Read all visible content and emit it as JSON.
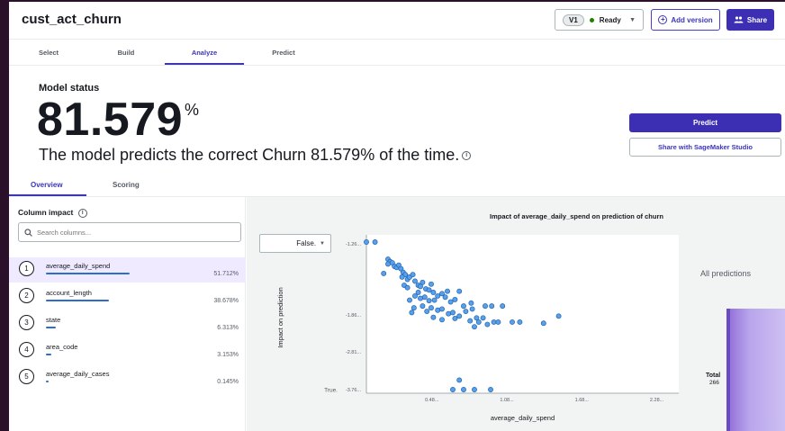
{
  "header": {
    "title": "cust_act_churn",
    "version_badge": "V1",
    "version_status": "Ready",
    "add_version_label": "Add version",
    "share_label": "Share"
  },
  "steps": [
    {
      "label": "Select"
    },
    {
      "label": "Build"
    },
    {
      "label": "Analyze"
    },
    {
      "label": "Predict"
    }
  ],
  "model_status": {
    "label": "Model status",
    "accuracy": "81.579",
    "unit": "%",
    "sentence": "The model predicts the correct Churn 81.579% of the time."
  },
  "actions": {
    "predict_label": "Predict",
    "studio_label": "Share with SageMaker Studio"
  },
  "subtabs": [
    {
      "label": "Overview"
    },
    {
      "label": "Scoring"
    }
  ],
  "column_impact": {
    "title": "Column impact",
    "search_placeholder": "Search columns...",
    "features": [
      {
        "rank": "1",
        "name": "average_daily_spend",
        "pct": "51.712%",
        "share": 0.517
      },
      {
        "rank": "2",
        "name": "account_length",
        "pct": "38.678%",
        "share": 0.387
      },
      {
        "rank": "3",
        "name": "state",
        "pct": "6.313%",
        "share": 0.063
      },
      {
        "rank": "4",
        "name": "area_code",
        "pct": "3.153%",
        "share": 0.032
      },
      {
        "rank": "5",
        "name": "average_daily_cases",
        "pct": "0.145%",
        "share": 0.0015
      }
    ]
  },
  "impact_chart": {
    "dropdown_value": "False.",
    "all_predictions_label": "All predictions",
    "total_label": "Total",
    "total_value": "266"
  },
  "chart_data": {
    "type": "scatter",
    "title": "Impact of average_daily_spend on prediction of churn",
    "xlabel": "average_daily_spend",
    "ylabel": "Impact on prediction",
    "x_ticks": [
      "0.48...",
      "1.08...",
      "1.68...",
      "2.28..."
    ],
    "y_ticks": [
      "-1.26...",
      "-1.86...",
      "-2.81...",
      "-3.76..."
    ],
    "y_end_labels": [
      "False.",
      "True."
    ],
    "grid": false,
    "points": [
      {
        "x": 0.0,
        "y": -1.27
      },
      {
        "x": 0.08,
        "y": -1.27
      },
      {
        "x": 0.2,
        "y": -1.56
      },
      {
        "x": 0.22,
        "y": -1.6
      },
      {
        "x": 0.2,
        "y": -1.64
      },
      {
        "x": 0.24,
        "y": -1.62
      },
      {
        "x": 0.26,
        "y": -1.68
      },
      {
        "x": 0.28,
        "y": -1.7
      },
      {
        "x": 0.3,
        "y": -1.66
      },
      {
        "x": 0.32,
        "y": -1.72
      },
      {
        "x": 0.34,
        "y": -1.78
      },
      {
        "x": 0.36,
        "y": -1.82
      },
      {
        "x": 0.33,
        "y": -1.86
      },
      {
        "x": 0.38,
        "y": -1.9
      },
      {
        "x": 0.4,
        "y": -1.86
      },
      {
        "x": 0.43,
        "y": -1.82
      },
      {
        "x": 0.45,
        "y": -1.93
      },
      {
        "x": 0.16,
        "y": -1.8
      },
      {
        "x": 0.35,
        "y": -2.0
      },
      {
        "x": 0.38,
        "y": -2.04
      },
      {
        "x": 0.48,
        "y": -2.0
      },
      {
        "x": 0.52,
        "y": -1.95
      },
      {
        "x": 0.55,
        "y": -2.06
      },
      {
        "x": 0.58,
        "y": -2.08
      },
      {
        "x": 0.6,
        "y": -1.98
      },
      {
        "x": 0.62,
        "y": -2.12
      },
      {
        "x": 0.48,
        "y": -2.12
      },
      {
        "x": 0.45,
        "y": -2.18
      },
      {
        "x": 0.5,
        "y": -2.22
      },
      {
        "x": 0.54,
        "y": -2.2
      },
      {
        "x": 0.58,
        "y": -2.26
      },
      {
        "x": 0.63,
        "y": -2.25
      },
      {
        "x": 0.66,
        "y": -2.18
      },
      {
        "x": 0.7,
        "y": -2.14
      },
      {
        "x": 0.73,
        "y": -2.2
      },
      {
        "x": 0.75,
        "y": -2.1
      },
      {
        "x": 0.78,
        "y": -2.28
      },
      {
        "x": 0.82,
        "y": -2.24
      },
      {
        "x": 0.86,
        "y": -2.1
      },
      {
        "x": 0.4,
        "y": -2.25
      },
      {
        "x": 0.44,
        "y": -2.38
      },
      {
        "x": 0.52,
        "y": -2.35
      },
      {
        "x": 0.56,
        "y": -2.44
      },
      {
        "x": 0.6,
        "y": -2.38
      },
      {
        "x": 0.66,
        "y": -2.42
      },
      {
        "x": 0.7,
        "y": -2.4
      },
      {
        "x": 0.76,
        "y": -2.48
      },
      {
        "x": 0.8,
        "y": -2.46
      },
      {
        "x": 0.86,
        "y": -2.52
      },
      {
        "x": 0.92,
        "y": -2.44
      },
      {
        "x": 0.98,
        "y": -2.4
      },
      {
        "x": 1.02,
        "y": -2.55
      },
      {
        "x": 1.08,
        "y": -2.55
      },
      {
        "x": 1.04,
        "y": -2.62
      },
      {
        "x": 1.12,
        "y": -2.66
      },
      {
        "x": 1.18,
        "y": -2.62
      },
      {
        "x": 1.0,
        "y": -2.7
      },
      {
        "x": 0.96,
        "y": -2.6
      },
      {
        "x": 0.9,
        "y": -2.35
      },
      {
        "x": 0.97,
        "y": -2.3
      },
      {
        "x": 1.1,
        "y": -2.35
      },
      {
        "x": 1.16,
        "y": -2.35
      },
      {
        "x": 1.26,
        "y": -2.35
      },
      {
        "x": 1.22,
        "y": -2.62
      },
      {
        "x": 1.35,
        "y": -2.62
      },
      {
        "x": 1.42,
        "y": -2.62
      },
      {
        "x": 1.64,
        "y": -2.64
      },
      {
        "x": 1.78,
        "y": -2.52
      },
      {
        "x": 0.42,
        "y": -2.46
      },
      {
        "x": 0.62,
        "y": -2.54
      },
      {
        "x": 0.7,
        "y": -2.58
      },
      {
        "x": 0.82,
        "y": -2.56
      },
      {
        "x": 0.86,
        "y": -3.6
      },
      {
        "x": 0.8,
        "y": -3.76
      },
      {
        "x": 0.9,
        "y": -3.76
      },
      {
        "x": 1.0,
        "y": -3.76
      },
      {
        "x": 1.15,
        "y": -3.76
      },
      {
        "x": 0.5,
        "y": -2.02
      }
    ]
  }
}
